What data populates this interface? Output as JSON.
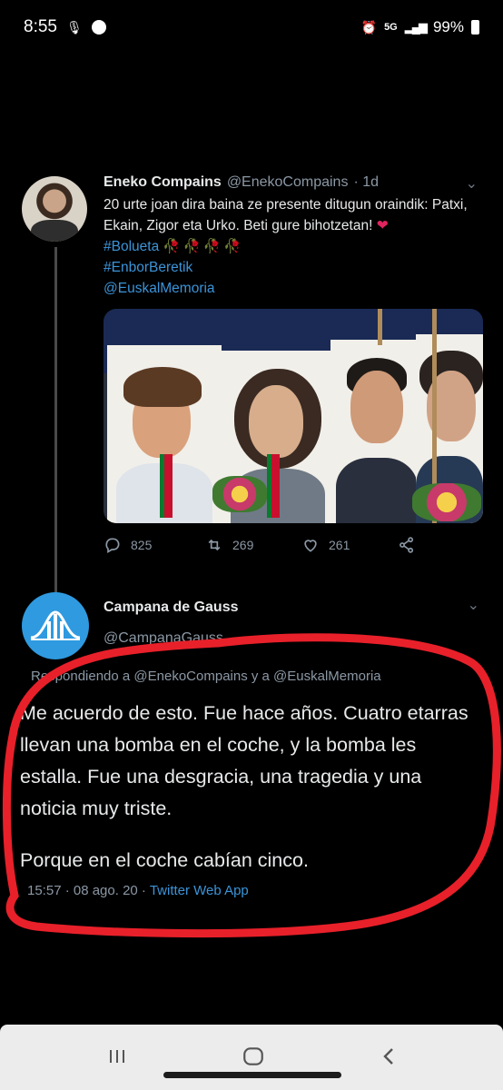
{
  "status_bar": {
    "time": "8:55",
    "network": "5G",
    "battery": "99%"
  },
  "tweet1": {
    "name": "Eneko Compains",
    "handle": "@EnekoCompains",
    "time": "· 1d",
    "text": "20 urte joan dira baina ze presente ditugun oraindik: Patxi, Ekain, Zigor eta Urko. Beti gure bihotzetan!",
    "hashtag1": "#Bolueta",
    "hashtag2": "#EnborBeretik",
    "mention": "@EuskalMemoria",
    "replies": "825",
    "retweets": "269",
    "likes": "261"
  },
  "tweet2": {
    "name": "Campana de Gauss",
    "handle": "@CampanaGauss",
    "reply_to": "Respondiendo a @EnekoCompains y a @EuskalMemoria",
    "text1": "Me acuerdo de esto. Fue hace años. Cuatro etarras llevan una bomba en el coche, y la bomba les estalla. Fue una desgracia, una tragedia y una noticia muy triste.",
    "text2": "Porque en el coche cabían cinco.",
    "time": "15:57 · 08 ago. 20 · ",
    "app": "Twitter Web App"
  },
  "colors": {
    "background": "#000000",
    "link": "#3b94d9",
    "secondary": "#8b98a5",
    "annotation": "#e8202a"
  },
  "icons": [
    "mic-icon",
    "whatsapp-icon",
    "alarm-icon",
    "signal-icon",
    "battery-icon",
    "chevron-down-icon",
    "reply-icon",
    "retweet-icon",
    "like-icon",
    "share-icon",
    "recents-icon",
    "home-icon",
    "back-icon"
  ]
}
